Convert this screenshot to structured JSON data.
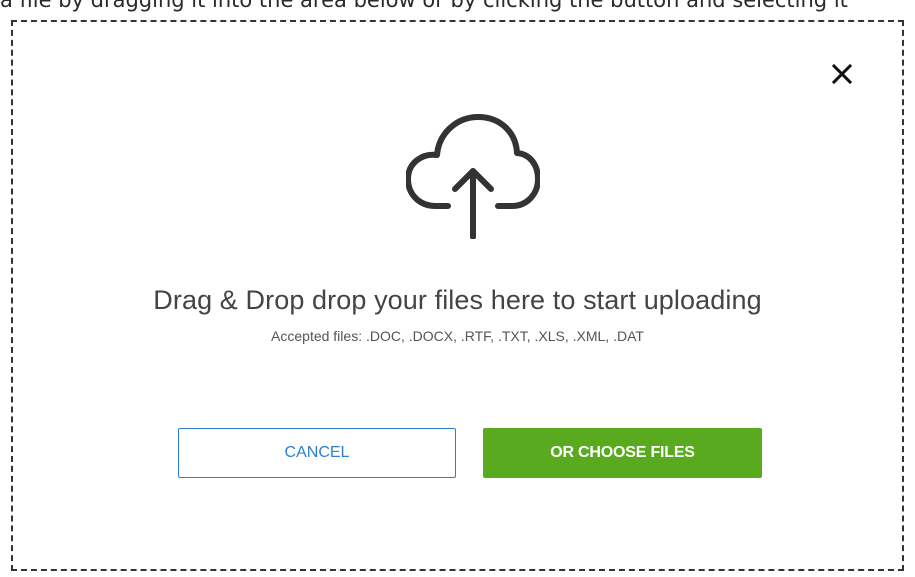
{
  "top_strip": {
    "text": "a file by dragging it into the area below or by clicking the button and selecting it"
  },
  "dialog": {
    "headline": "Drag & Drop drop your files here to start uploading",
    "accepted_files": "Accepted files: .DOC, .DOCX, .RTF, .TXT, .XLS, .XML, .DAT",
    "cancel_label": "CANCEL",
    "choose_label": "OR CHOOSE FILES"
  },
  "icons": {
    "close": "close-icon",
    "upload": "cloud-upload-icon"
  },
  "colors": {
    "cancel_border": "#2f7fd1",
    "choose_background": "#5aaa1f",
    "dashed_border": "#333333"
  }
}
